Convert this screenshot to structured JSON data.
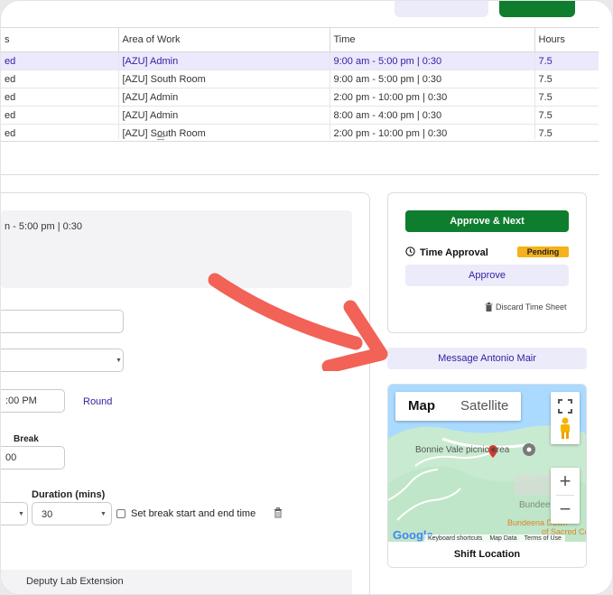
{
  "table": {
    "headers": [
      "s",
      "Area of Work",
      "Time",
      "Hours"
    ],
    "rows": [
      {
        "status": "ed",
        "area": "[AZU] Admin",
        "time": "9:00 am - 5:00 pm | 0:30",
        "hours": "7.5",
        "selected": true
      },
      {
        "status": "ed",
        "area": "[AZU] South Room",
        "time": "9:00 am - 5:00 pm | 0:30",
        "hours": "7.5",
        "selected": false
      },
      {
        "status": "ed",
        "area": "[AZU] Admin",
        "time": "2:00 pm - 10:00 pm | 0:30",
        "hours": "7.5",
        "selected": false
      },
      {
        "status": "ed",
        "area": "[AZU] Admin",
        "time": "8:00 am - 4:00 pm | 0:30",
        "hours": "7.5",
        "selected": false
      },
      {
        "status": "ed",
        "area": "[AZU] South Room",
        "time": "2:00 pm - 10:00 pm | 0:30",
        "hours": "7.5",
        "selected": false
      }
    ]
  },
  "editor": {
    "time_summary": "n - 5:00 pm | 0:30",
    "end_time_value": ":00 PM",
    "round_link": "Round",
    "break_label": "Break",
    "break_value": "00",
    "duration_label": "Duration (mins)",
    "duration_value": "30",
    "set_break_label": "Set break start and end time",
    "extension_text": "Deputy Lab Extension"
  },
  "approval": {
    "approve_next_label": "Approve & Next",
    "time_approval_label": "Time Approval",
    "pending_badge": "Pending",
    "approve_label": "Approve",
    "discard_label": "Discard Time Sheet",
    "message_label": "Message Antonio Mair"
  },
  "map": {
    "tab_map": "Map",
    "tab_satellite": "Satellite",
    "place_label": "Bonnie Vale picnic area",
    "place_label2": "Bundeena",
    "place_label3": "Bundeena Down",
    "place_label4": "of Sacred Colli",
    "google_logo": "Google",
    "footer_shortcuts": "Keyboard shortcuts",
    "footer_data": "Map Data",
    "footer_terms": "Terms of Use",
    "shift_location_label": "Shift Location"
  },
  "colors": {
    "accent_green": "#0e7d2d",
    "accent_purple": "#2e1fa0",
    "pending": "#f5b21b",
    "arrow": "#f26257"
  }
}
